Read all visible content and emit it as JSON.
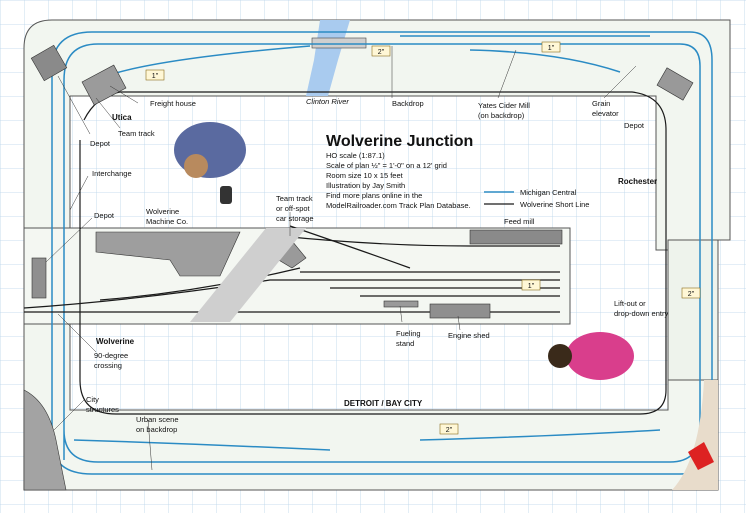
{
  "title": "Wolverine Junction",
  "info_lines": [
    "HO scale (1:87.1)",
    "Scale of plan ½\" = 1'-0\" on a 12' grid",
    "Room size 10 x 15 feet",
    "Illustration by Jay Smith"
  ],
  "find_more": [
    "Find more plans online in the",
    "ModelRailroader.com Track Plan Database."
  ],
  "legend": {
    "michigan_central": "Michigan Central",
    "wolverine_short_line": "Wolverine Short Line",
    "colors": {
      "michigan_central": "#2b8bc4",
      "wolverine_short_line": "#1a1a1a"
    }
  },
  "labels": {
    "utica": "Utica",
    "freight_house": "Freight house",
    "team_track": "Team track",
    "depot_utica": "Depot",
    "interchange": "Interchange",
    "depot_wolverine": "Depot",
    "wolverine_machine": [
      "Wolverine",
      "Machine Co."
    ],
    "team_track_offspot": [
      "Team track",
      "or off-spot",
      "car storage"
    ],
    "feed_mill": "Feed mill",
    "clinton_river": "Clinton River",
    "backdrop": "Backdrop",
    "yates": [
      "Yates Cider Mill",
      "(on backdrop)"
    ],
    "grain_elevator": [
      "Grain",
      "elevator"
    ],
    "depot_rochester": "Depot",
    "rochester": "Rochester",
    "wolverine": "Wolverine",
    "crossing": [
      "90-degree",
      "crossing"
    ],
    "city_structures": [
      "City",
      "structures"
    ],
    "urban_scene": [
      "Urban scene",
      "on backdrop"
    ],
    "fueling_stand": [
      "Fueling",
      "stand"
    ],
    "engine_shed": "Engine shed",
    "detroit": "DETROIT / BAY CITY",
    "liftout": [
      "Lift-out or",
      "drop-down entry"
    ]
  },
  "grades": {
    "g1": "1\"",
    "g2": "2\"",
    "g3": "1\"",
    "g4": "1\"",
    "g5": "2\"",
    "g6": "2\""
  }
}
